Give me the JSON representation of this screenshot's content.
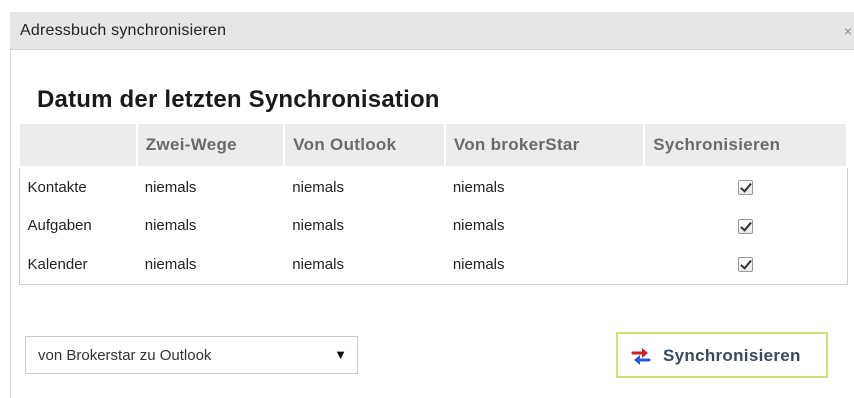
{
  "dialog": {
    "title": "Adressbuch synchronisieren",
    "close_icon": "×",
    "heading": "Datum der letzten Synchronisation"
  },
  "table": {
    "headers": [
      "",
      "Zwei-Wege",
      "Von Outlook",
      "Von brokerStar",
      "Sychronisieren"
    ],
    "rows": [
      {
        "label": "Kontakte",
        "two_way": "niemals",
        "from_outlook": "niemals",
        "from_brokerstar": "niemals",
        "sync_checked": true
      },
      {
        "label": "Aufgaben",
        "two_way": "niemals",
        "from_outlook": "niemals",
        "from_brokerstar": "niemals",
        "sync_checked": true
      },
      {
        "label": "Kalender",
        "two_way": "niemals",
        "from_outlook": "niemals",
        "from_brokerstar": "niemals",
        "sync_checked": true
      }
    ]
  },
  "direction_select": {
    "selected": "von Brokerstar zu Outlook",
    "arrow": "▼"
  },
  "sync_button": {
    "label": "Synchronisieren",
    "icon": "sync-arrows-icon"
  },
  "colors": {
    "button_border": "#cfe27a",
    "icon_red": "#d0202a",
    "icon_blue": "#2a5bd7",
    "header_bg": "#ececec"
  }
}
